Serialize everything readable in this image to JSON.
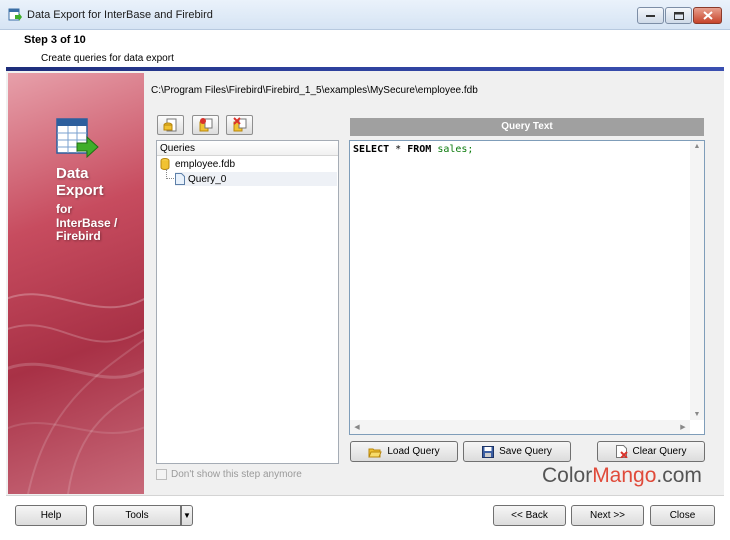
{
  "window": {
    "title": "Data Export for InterBase and Firebird"
  },
  "header": {
    "step": "Step 3 of 10",
    "description": "Create queries for data export"
  },
  "banner": {
    "line1": "Data",
    "line2": "Export",
    "line3": "for",
    "line4": "InterBase /",
    "line5": "Firebird"
  },
  "database_path": "C:\\Program Files\\Firebird\\Firebird_1_5\\examples\\MySecure\\employee.fdb",
  "tree": {
    "header": "Queries",
    "root": "employee.fdb",
    "child": "Query_0"
  },
  "query": {
    "header": "Query Text",
    "kw1": "SELECT",
    "star": " * ",
    "kw2": "FROM",
    "table": "sales",
    "semicolon": ";"
  },
  "buttons": {
    "load": "Load Query",
    "save": "Save Query",
    "clear": "Clear Query",
    "help": "Help",
    "tools": "Tools",
    "back": "<< Back",
    "next": "Next >>",
    "close": "Close"
  },
  "checkbox": {
    "label": "Don't show this step anymore",
    "checked": false
  },
  "watermark": {
    "part1": "Color",
    "part2": "Mango",
    "part3": ".com"
  },
  "colors": {
    "accent_line": "#1d2d7a",
    "banner": "#b63a50",
    "query_header": "#a0a0a0"
  }
}
